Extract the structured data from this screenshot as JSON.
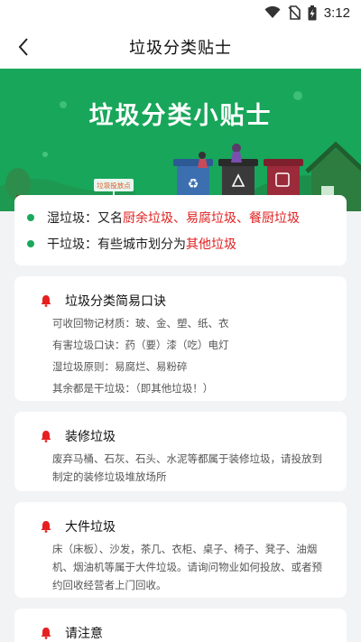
{
  "status_bar": {
    "time": "3:12",
    "icons": [
      "wifi-icon",
      "no-sim-icon",
      "battery-charging-icon"
    ]
  },
  "header": {
    "title": "垃圾分类贴士",
    "back_icon": "back-arrow-icon"
  },
  "banner": {
    "title": "垃圾分类小贴士",
    "tag": "垃圾投放点",
    "bg_color": "#18a65a"
  },
  "definitions": [
    {
      "label": "湿垃圾：又名",
      "highlight": "厨余垃圾、易腐垃圾、餐厨垃圾"
    },
    {
      "label": "干垃圾：有些城市划分为",
      "highlight": "其他垃圾"
    }
  ],
  "tips": [
    {
      "title": "垃圾分类简易口诀",
      "lines": [
        "可收回物记材质：玻、金、塑、纸、衣",
        "有害垃圾口诀：药（要）漆（吃）电灯",
        "湿垃圾原则：易腐烂、易粉碎",
        "其余都是干垃圾：（即其他垃圾！）"
      ]
    },
    {
      "title": "装修垃圾",
      "body": "废弃马桶、石灰、石头、水泥等都属于装修垃圾，请投放到制定的装修垃圾堆放场所"
    },
    {
      "title": "大件垃圾",
      "body": "床（床板）、沙发，茶几、衣柜、桌子、椅子、凳子、油烟机、烟油机等属于大件垃圾。请询问物业如何投放、或者预约回收经营者上门回收。"
    },
    {
      "title": "请注意"
    }
  ],
  "colors": {
    "accent_green": "#1aa85e",
    "highlight_red": "#e02020",
    "bell_red": "#e62020"
  }
}
